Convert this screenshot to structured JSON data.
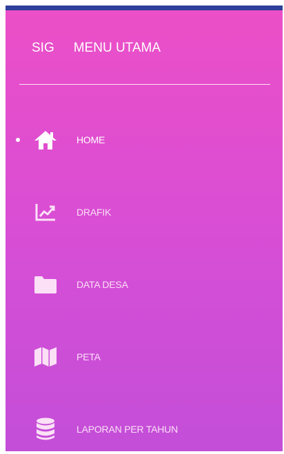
{
  "header": {
    "brand": "SIG",
    "title": "MENU UTAMA"
  },
  "menu": {
    "items": [
      {
        "label": "HOME",
        "icon": "home-icon",
        "active": true
      },
      {
        "label": "DRAFIK",
        "icon": "chart-line-icon",
        "active": false
      },
      {
        "label": "DATA DESA",
        "icon": "folder-icon",
        "active": false
      },
      {
        "label": "PETA",
        "icon": "map-icon",
        "active": false
      },
      {
        "label": "LAPORAN PER TAHUN",
        "icon": "database-icon",
        "active": false
      }
    ]
  },
  "colors": {
    "topbar": "#2f3f9a",
    "drawer_top": "#ec4fc7",
    "drawer_bottom": "#c34ed8",
    "text": "#ffffff"
  }
}
